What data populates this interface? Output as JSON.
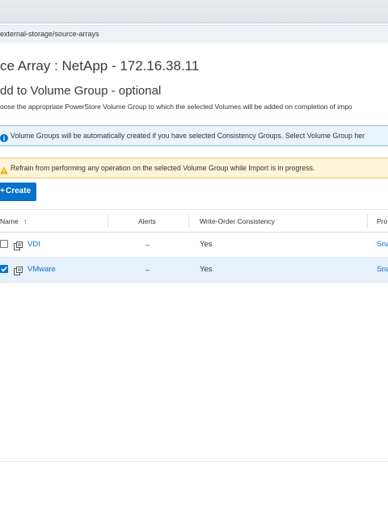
{
  "browser": {
    "url_fragment": "external-storage/source-arrays"
  },
  "page": {
    "title": "ce Array : NetApp - 172.16.38.11",
    "step_title": "dd to Volume Group - optional",
    "description": "oose the appropriate PowerStore Volume Group to which the selected Volumes will be added on completion of impo"
  },
  "banners": {
    "info": "Volume Groups will be automatically created if you have selected Consistency Groups. Select Volume Group her",
    "warning": "Refrain from performing any operation on the selected Volume Group while Import is in progress."
  },
  "toolbar": {
    "create_plus": "+",
    "create_label": "Create"
  },
  "table": {
    "headers": {
      "name": "Name",
      "sort_arrow": "↑",
      "alerts": "Alerts",
      "write_order": "Write-Order Consistency",
      "protection": "Pro"
    },
    "rows": [
      {
        "name": "VDI",
        "alerts": "–",
        "write_order": "Yes",
        "protection": "Sna",
        "selected": false
      },
      {
        "name": "VMware",
        "alerts": "–",
        "write_order": "Yes",
        "protection": "Sna",
        "selected": true
      }
    ]
  },
  "colors": {
    "accent": "#0672cb",
    "info_bg": "#eaf3fb",
    "warning_bg": "#fdf4d9",
    "selected_row_bg": "#e6f1fb"
  }
}
